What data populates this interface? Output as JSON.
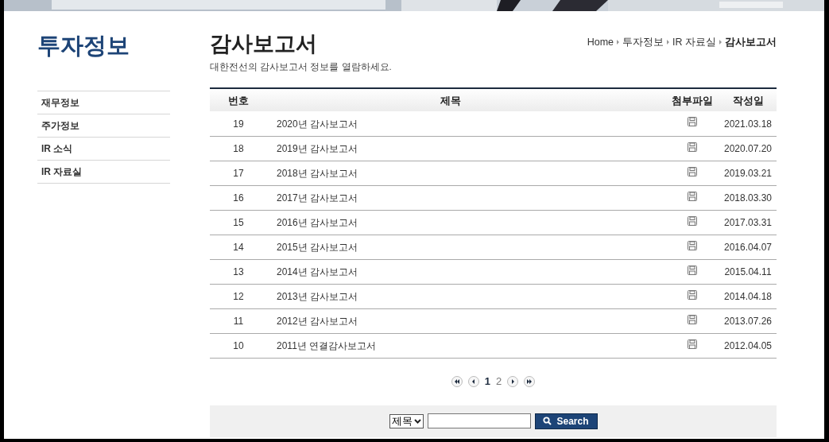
{
  "sidebar": {
    "title": "투자정보",
    "items": [
      {
        "label": "재무정보"
      },
      {
        "label": "주가정보"
      },
      {
        "label": "IR 소식"
      },
      {
        "label": "IR 자료실"
      }
    ]
  },
  "page": {
    "title": "감사보고서",
    "subtitle": "대한전선의 감사보고서 정보를 열람하세요.",
    "breadcrumb": [
      "Home",
      "투자정보",
      "IR 자료실",
      "감사보고서"
    ]
  },
  "table": {
    "columns": [
      "번호",
      "제목",
      "첨부파일",
      "작성일"
    ],
    "rows": [
      {
        "no": "19",
        "title": "2020년 감사보고서",
        "date": "2021.03.18"
      },
      {
        "no": "18",
        "title": "2019년 감사보고서",
        "date": "2020.07.20"
      },
      {
        "no": "17",
        "title": "2018년 감사보고서",
        "date": "2019.03.21"
      },
      {
        "no": "16",
        "title": "2017년 감사보고서",
        "date": "2018.03.30"
      },
      {
        "no": "15",
        "title": "2016년 감사보고서",
        "date": "2017.03.31"
      },
      {
        "no": "14",
        "title": "2015년 감사보고서",
        "date": "2016.04.07"
      },
      {
        "no": "13",
        "title": "2014년 감사보고서",
        "date": "2015.04.11"
      },
      {
        "no": "12",
        "title": "2013년 감사보고서",
        "date": "2014.04.18"
      },
      {
        "no": "11",
        "title": "2012년 감사보고서",
        "date": "2013.07.26"
      },
      {
        "no": "10",
        "title": "2011년 연결감사보고서",
        "date": "2012.04.05"
      }
    ]
  },
  "pagination": {
    "pages": [
      {
        "label": "1",
        "selected": true
      },
      {
        "label": "2",
        "selected": false
      }
    ]
  },
  "search": {
    "select": "제목",
    "button": "Search"
  }
}
